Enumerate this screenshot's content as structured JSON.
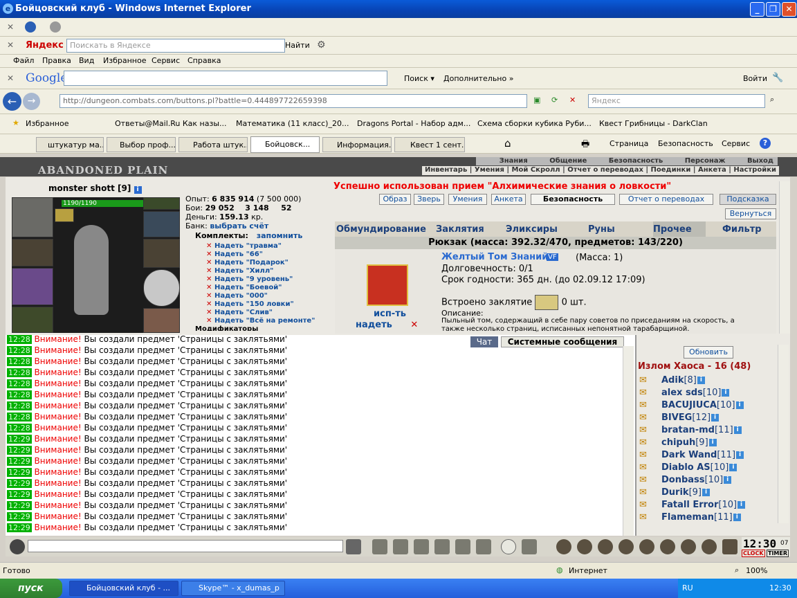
{
  "window": {
    "title": "Бойцовский клуб - Windows Internet Explorer"
  },
  "yandex": {
    "logo": "Яндекс",
    "search_placeholder": "Поискать в Яндексе",
    "find": "Найти"
  },
  "menu": [
    "Файл",
    "Правка",
    "Вид",
    "Избранное",
    "Сервис",
    "Справка"
  ],
  "google": {
    "logo": "Google",
    "search": "Поиск",
    "more": "Дополнительно »",
    "login": "Войти"
  },
  "address": {
    "url": "http://dungeon.combats.com/buttons.pl?battle=0.444897722659398",
    "search_placeholder": "Яндекс"
  },
  "favorites": {
    "label": "Избранное",
    "links": [
      "Ответы@Mail.Ru Как назы...",
      "Математика (11 класс)_20...",
      "Dragons Portal - Набор адм...",
      "Схема сборки кубика Руби...",
      "Квест Грибницы - DarkClan"
    ]
  },
  "tabs": [
    "штукатур ма...",
    "Выбор проф...",
    "Работа штук...",
    "Бойцовск...",
    "Информация...",
    "Квест 1 сент..."
  ],
  "ie_cmds": {
    "page": "Страница",
    "security": "Безопасность",
    "service": "Сервис"
  },
  "game": {
    "title": "ABANDONED PLAIN",
    "nav1": [
      "Знания",
      "Общение",
      "Безопасность",
      "Персонаж",
      "Выход"
    ],
    "nav2": "Инвентарь | Умения | Мой Скролл | Отчет о переводах | Поединки | Анкета | Настройки",
    "char_name": "monster shott [9]",
    "hp": "1190/1190",
    "exp_label": "Опыт:",
    "exp": "6 835 914",
    "exp_next": "(7 500 000)",
    "fights_label": "Бои:",
    "wins": "29 052",
    "losses": "3 148",
    "draws": "52",
    "money_label": "Деньги:",
    "money": "159.13",
    "money_unit": "кр.",
    "bank_label": "Банк:",
    "bank_link": "выбрать счёт",
    "sets_label": "Комплекты:",
    "remember": "запомнить",
    "sets": [
      "Надеть \"травма\"",
      "Надеть \"66\"",
      "Надеть \"Подарок\"",
      "Надеть \"Хилл\"",
      "Надеть \"9 уровень\"",
      "Надеть \"Боевой\"",
      "Надеть \"000\"",
      "Надеть \"150 ловки\"",
      "Надеть \"Слив\"",
      "Надеть \"Всё на ремонте\""
    ],
    "modifiers": "Модификаторы",
    "success_msg": "Успешно использован прием \"Алхимические знания о ловкости\"",
    "buttons": [
      "Образ",
      "Зверь",
      "Умения",
      "Анкета",
      "Безопасность",
      "Отчет о переводах",
      "Подсказка",
      "Вернуться"
    ],
    "inv_tabs": [
      "Обмундирование",
      "Заклятия",
      "Эликсиры",
      "Руны",
      "Прочее",
      "Фильтр"
    ],
    "backpack": "Рюкзак (масса: 392.32/470, предметов: 143/220)",
    "item": {
      "name": "Желтый Том Знаний",
      "badge": "VF",
      "mass": "(Масса: 1)",
      "durability": "Долговечность: 0/1",
      "expiry": "Срок годности: 365 дн. (до 02.09.12 17:09)",
      "spell_label": "Встроено заклятие",
      "spell_count": "0 шт.",
      "desc_label": "Описание:",
      "desc": "Пыльный том, содержащий в себе пару советов по приседаниям на скорость, а также несколько страниц, исписанных непонятной тарабарщиной.",
      "use": "исп-ть",
      "wear": "надеть"
    }
  },
  "chat": {
    "tab_chat": "Чат",
    "tab_system": "Системные сообщения",
    "refresh": "Обновить",
    "lines": [
      {
        "t": "12:28",
        "w": "Внимание!",
        "m": "Вы создали предмет 'Страницы с заклятьями'"
      },
      {
        "t": "12:28",
        "w": "Внимание!",
        "m": "Вы создали предмет 'Страницы с заклятьями'"
      },
      {
        "t": "12:28",
        "w": "Внимание!",
        "m": "Вы создали предмет 'Страницы с заклятьями'"
      },
      {
        "t": "12:28",
        "w": "Внимание!",
        "m": "Вы создали предмет 'Страницы с заклятьями'"
      },
      {
        "t": "12:28",
        "w": "Внимание!",
        "m": "Вы создали предмет 'Страницы с заклятьями'"
      },
      {
        "t": "12:28",
        "w": "Внимание!",
        "m": "Вы создали предмет 'Страницы с заклятьями'"
      },
      {
        "t": "12:28",
        "w": "Внимание!",
        "m": "Вы создали предмет 'Страницы с заклятьями'"
      },
      {
        "t": "12:28",
        "w": "Внимание!",
        "m": "Вы создали предмет 'Страницы с заклятьями'"
      },
      {
        "t": "12:28",
        "w": "Внимание!",
        "m": "Вы создали предмет 'Страницы с заклятьями'"
      },
      {
        "t": "12:29",
        "w": "Внимание!",
        "m": "Вы создали предмет 'Страницы с заклятьями'"
      },
      {
        "t": "12:29",
        "w": "Внимание!",
        "m": "Вы создали предмет 'Страницы с заклятьями'"
      },
      {
        "t": "12:29",
        "w": "Внимание!",
        "m": "Вы создали предмет 'Страницы с заклятьями'"
      },
      {
        "t": "12:29",
        "w": "Внимание!",
        "m": "Вы создали предмет 'Страницы с заклятьями'"
      },
      {
        "t": "12:29",
        "w": "Внимание!",
        "m": "Вы создали предмет 'Страницы с заклятьями'"
      },
      {
        "t": "12:29",
        "w": "Внимание!",
        "m": "Вы создали предмет 'Страницы с заклятьями'"
      },
      {
        "t": "12:29",
        "w": "Внимание!",
        "m": "Вы создали предмет 'Страницы с заклятьями'"
      },
      {
        "t": "12:29",
        "w": "Внимание!",
        "m": "Вы создали предмет 'Страницы с заклятьями'"
      },
      {
        "t": "12:29",
        "w": "Внимание!",
        "m": "Вы создали предмет 'Страницы с заклятьями'"
      }
    ]
  },
  "room": {
    "title": "Излом Хаоса - 16 (48)",
    "users": [
      {
        "n": "Adik",
        "l": "[8]"
      },
      {
        "n": "alex sds",
        "l": "[10]"
      },
      {
        "n": "BACUJIUCA",
        "l": "[10]"
      },
      {
        "n": "BIVEG",
        "l": "[12]"
      },
      {
        "n": "bratan-md",
        "l": "[11]"
      },
      {
        "n": "chipuh",
        "l": "[9]"
      },
      {
        "n": "Dark Wand",
        "l": "[11]"
      },
      {
        "n": "Diablo AS",
        "l": "[10]"
      },
      {
        "n": "Donbass",
        "l": "[10]"
      },
      {
        "n": "Durik",
        "l": "[9]"
      },
      {
        "n": "Fatall Error",
        "l": "[10]"
      },
      {
        "n": "Flameman",
        "l": "[11]"
      }
    ]
  },
  "clock": {
    "time": "12:30",
    "sec": "07",
    "clock_label": "CLOCK",
    "timer_label": "TIMER"
  },
  "status": {
    "ready": "Готово",
    "zone": "Интернет",
    "zoom": "100%"
  },
  "taskbar": {
    "start": "пуск",
    "tasks": [
      "Бойцовский клуб - ...",
      "Skype™ - x_dumas_p"
    ],
    "lang": "RU",
    "time": "12:30"
  }
}
